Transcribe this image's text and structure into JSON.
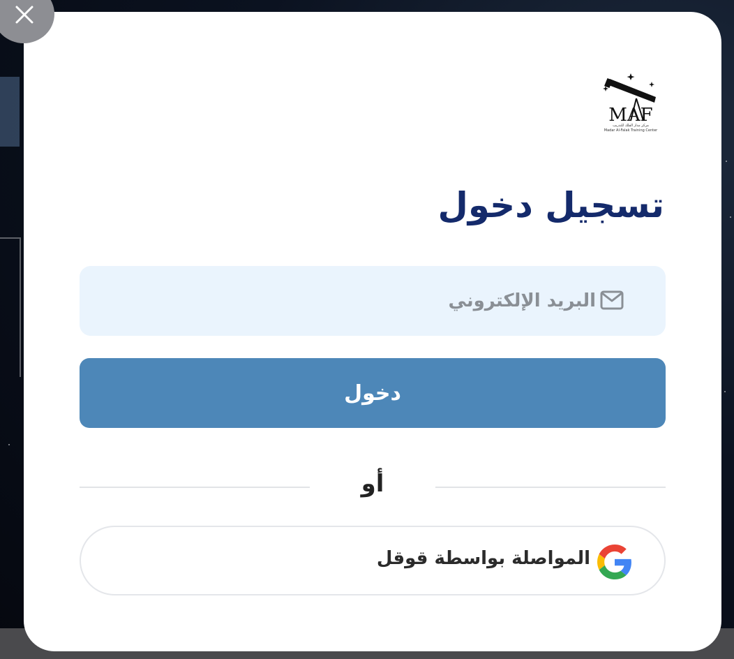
{
  "modal": {
    "logo_text": "MAF",
    "logo_caption_ar": "مركز مدار الفلك للتدريب",
    "logo_caption_en": "Madar Al-Falak Training Center",
    "title": "تسجيل دخول",
    "email": {
      "placeholder": "البريد الإلكتروني",
      "value": "",
      "icon": "mail-icon"
    },
    "login_button": "دخول",
    "divider_text": "أو",
    "google_button": {
      "label": "المواصلة بواسطة قوقل",
      "icon": "google-icon"
    },
    "close_icon": "close-icon"
  },
  "colors": {
    "title": "#142a6b",
    "primary_button": "#4d87b8",
    "input_background": "#eaf4fd",
    "modal_background": "#ffffff",
    "close_button": "#8d8e93"
  }
}
